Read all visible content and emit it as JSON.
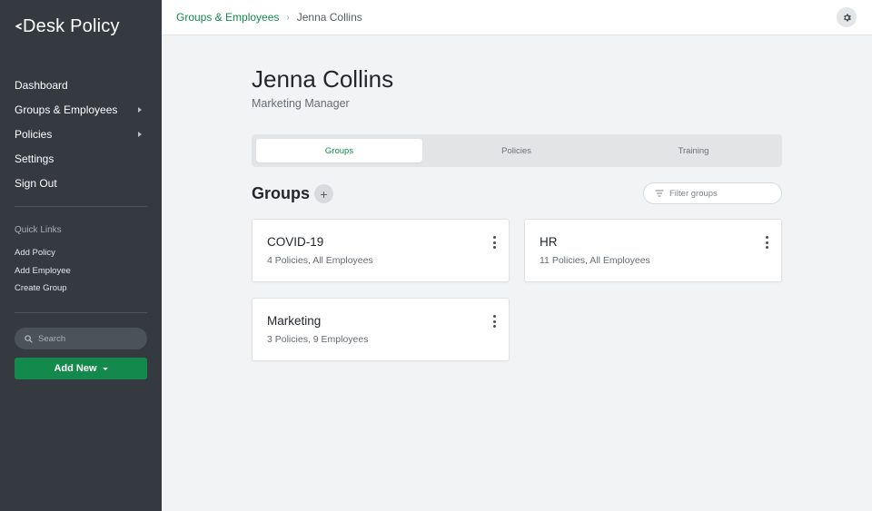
{
  "app": {
    "logo_text": "Desk Policy"
  },
  "sidebar": {
    "nav": [
      {
        "label": "Dashboard"
      },
      {
        "label": "Groups & Employees"
      },
      {
        "label": "Policies"
      },
      {
        "label": "Settings"
      },
      {
        "label": "Sign Out"
      }
    ],
    "quick_links_title": "Quick Links",
    "quick_links": [
      {
        "label": "Add Policy"
      },
      {
        "label": "Add Employee"
      },
      {
        "label": "Create Group"
      }
    ],
    "search_placeholder": "Search",
    "add_new_label": "Add New"
  },
  "breadcrumb": {
    "parent": "Groups & Employees",
    "separator": "›",
    "current": "Jenna Collins"
  },
  "employee": {
    "name": "Jenna Collins",
    "title": "Marketing Manager"
  },
  "tabs": [
    {
      "label": "Groups",
      "active": true
    },
    {
      "label": "Policies",
      "active": false
    },
    {
      "label": "Training",
      "active": false
    }
  ],
  "groups_section": {
    "title": "Groups",
    "add_symbol": "+",
    "filter_placeholder": "Filter groups"
  },
  "groups": [
    {
      "name": "COVID-19",
      "meta": "4 Policies, All Employees"
    },
    {
      "name": "HR",
      "meta": "11 Policies, All Employees"
    },
    {
      "name": "Marketing",
      "meta": "3 Policies, 9 Employees"
    }
  ],
  "colors": {
    "sidebar_bg": "#343a40",
    "accent_green": "#138a4b",
    "page_bg": "#f2f3f4"
  }
}
